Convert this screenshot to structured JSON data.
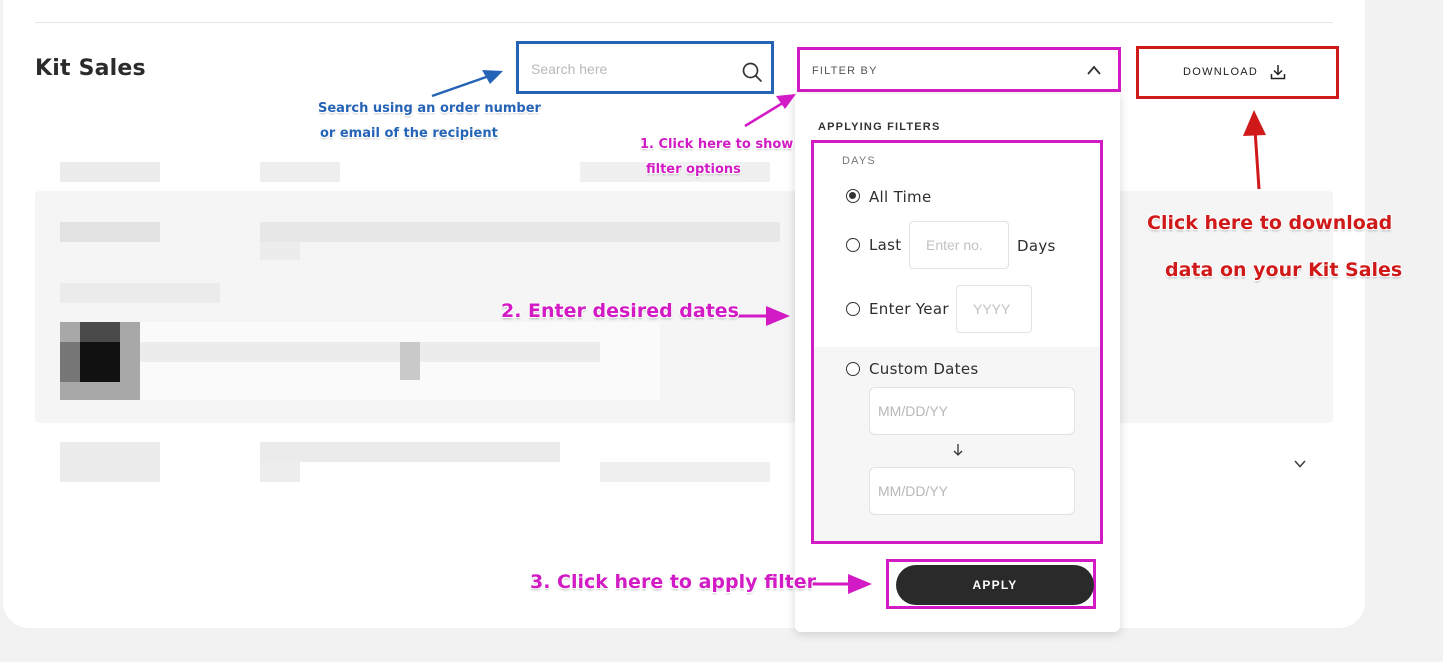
{
  "page": {
    "title": "Kit Sales"
  },
  "search": {
    "placeholder": "Search here",
    "icon": "search-icon"
  },
  "filter": {
    "label": "FILTER BY",
    "icon": "chevron-up-icon"
  },
  "download": {
    "label": "DOWNLOAD",
    "icon": "download-icon"
  },
  "dropdown": {
    "heading": "APPLYING FILTERS",
    "days_label": "DAYS",
    "options": {
      "all_time": "All Time",
      "last": "Last",
      "last_placeholder": "Enter no.",
      "last_suffix": "Days",
      "enter_year": "Enter Year",
      "year_placeholder": "YYYY",
      "custom_dates": "Custom Dates",
      "from_placeholder": "MM/DD/YY",
      "to_placeholder": "MM/DD/YY"
    },
    "selected_option": "All Time",
    "apply_label": "APPLY"
  },
  "annotations": {
    "search_hint_line1": "Search using an order number",
    "search_hint_line2": "or email of the recipient",
    "step1_line1": "1. Click here to show",
    "step1_line2": "filter options",
    "step2": "2. Enter desired dates",
    "step3": "3. Click here to apply filter",
    "download_hint_line1": "Click here to download",
    "download_hint_line2": "data on your Kit Sales"
  },
  "colors": {
    "annotation_blue": "#2563b6",
    "annotation_magenta": "#d21bc4",
    "annotation_red": "#d01a1a",
    "apply_button": "#2a2a2a"
  }
}
